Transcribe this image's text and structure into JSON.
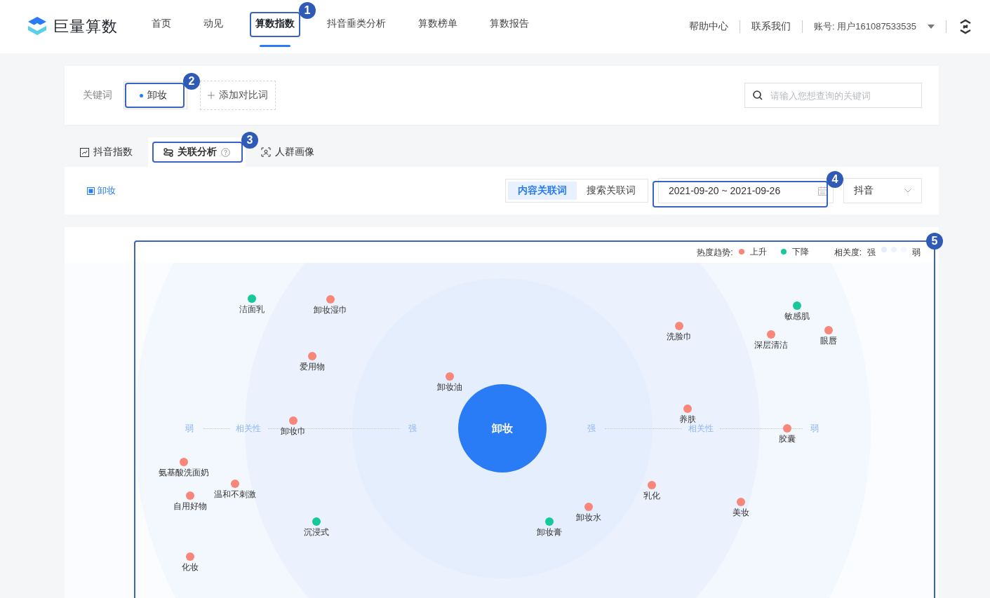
{
  "brand": {
    "name": "巨量算数"
  },
  "nav": [
    {
      "label": "首页",
      "selected": false
    },
    {
      "label": "动见",
      "selected": false
    },
    {
      "label": "算数指数",
      "selected": true,
      "callout": "1"
    },
    {
      "label": "抖音垂类分析",
      "selected": false
    },
    {
      "label": "算数榜单",
      "selected": false
    },
    {
      "label": "算数报告",
      "selected": false
    }
  ],
  "header_links": [
    "帮助中心",
    "联系我们"
  ],
  "account": "账号: 用户161087533535",
  "keywords": {
    "label": "关键词",
    "items": [
      {
        "text": "卸妆",
        "color": "#2a7cf6",
        "callout": "2"
      }
    ],
    "add": "添加对比词",
    "search_placeholder": "请输入您想查询的关键词"
  },
  "tabs": [
    {
      "label": "抖音指数",
      "selected": false
    },
    {
      "label": "关联分析",
      "selected": true,
      "help": true,
      "callout": "3"
    },
    {
      "label": "人群画像",
      "selected": false
    }
  ],
  "filters": {
    "keyword": "卸妆",
    "modes": [
      {
        "label": "内容关联词",
        "selected": true
      },
      {
        "label": "搜索关联词",
        "selected": false
      }
    ],
    "date_range": "2021-09-20 ~ 2021-09-26",
    "date_callout": "4",
    "platform": "抖音"
  },
  "graph": {
    "callout": "5",
    "legend": {
      "trend_label": "热度趋势:",
      "trends": [
        {
          "label": "上升",
          "color": "#f8877a"
        },
        {
          "label": "下降",
          "color": "#16c89a"
        }
      ],
      "relevance_label": "相关度:",
      "strong": "强",
      "weak": "弱"
    },
    "center": "卸妆",
    "axis_left": [
      "弱",
      "相关性",
      "强"
    ],
    "axis_right": [
      "强",
      "相关性",
      "弱"
    ],
    "nodes": [
      {
        "label": "洁面乳",
        "color": "#16c89a"
      },
      {
        "label": "卸妆湿巾",
        "color": "#f8877a"
      },
      {
        "label": "爱用物",
        "color": "#f8877a"
      },
      {
        "label": "卸妆油",
        "color": "#f8877a"
      },
      {
        "label": "卸妆巾",
        "color": "#f8877a"
      },
      {
        "label": "氨基酸洗面奶",
        "color": "#f8877a"
      },
      {
        "label": "温和不刺激",
        "color": "#f8877a"
      },
      {
        "label": "自用好物",
        "color": "#f8877a"
      },
      {
        "label": "沉浸式",
        "color": "#16c89a"
      },
      {
        "label": "化妆",
        "color": "#f8877a"
      },
      {
        "label": "卸妆膏",
        "color": "#16c89a"
      },
      {
        "label": "卸妆水",
        "color": "#f8877a"
      },
      {
        "label": "乳化",
        "color": "#f8877a"
      },
      {
        "label": "美妆",
        "color": "#f8877a"
      },
      {
        "label": "养肤",
        "color": "#f8877a"
      },
      {
        "label": "胶囊",
        "color": "#f8877a"
      },
      {
        "label": "洗脸巾",
        "color": "#f8877a"
      },
      {
        "label": "深层清洁",
        "color": "#f8877a"
      },
      {
        "label": "敏感肌",
        "color": "#16c89a"
      },
      {
        "label": "眼唇",
        "color": "#f8877a"
      }
    ]
  }
}
